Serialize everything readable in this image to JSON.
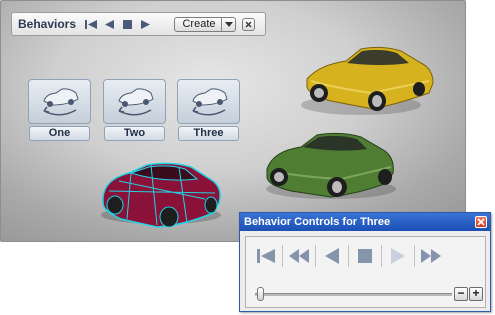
{
  "behaviors_panel": {
    "title": "Behaviors",
    "create_label": "Create"
  },
  "behavior_tiles": [
    {
      "label": "One"
    },
    {
      "label": "Two"
    },
    {
      "label": "Three"
    }
  ],
  "scene": {
    "cars": [
      {
        "name": "yellow-car",
        "color": "#d6b21e"
      },
      {
        "name": "green-car",
        "color": "#4f7d32"
      },
      {
        "name": "crimson-wireframe-car",
        "color": "#8a1238",
        "wire_color": "#21d3e6"
      }
    ]
  },
  "controls_window": {
    "title": "Behavior Controls for Three",
    "slider_position": 0,
    "zoom_out_label": "−",
    "zoom_in_label": "+"
  },
  "colors": {
    "titlebar": "#2a62c8",
    "close_button": "#d84a2a",
    "tile_border": "#8ea2b8"
  }
}
